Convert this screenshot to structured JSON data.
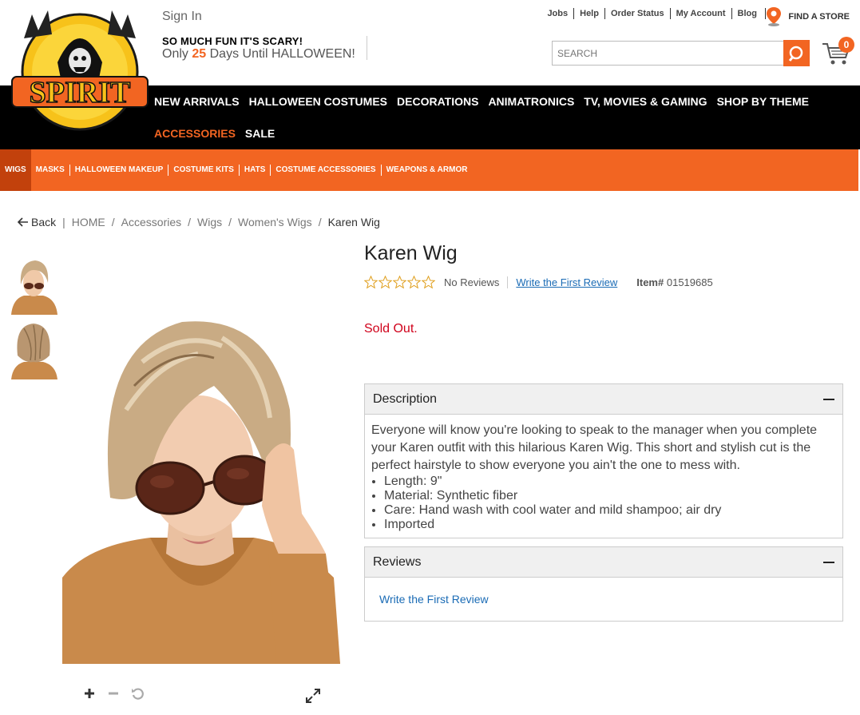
{
  "header": {
    "sign_in": "Sign In",
    "tagline_line1": "SO MUCH FUN IT'S SCARY!",
    "tagline_only": "Only",
    "tagline_days": "25",
    "tagline_rest": "Days Until HALLOWEEN!",
    "top_links": [
      "Jobs",
      "Help",
      "Order Status",
      "My Account",
      "Blog"
    ],
    "find_store": "FIND A STORE",
    "search_placeholder": "SEARCH",
    "cart_count": "0",
    "logo_text": "SPIRIT"
  },
  "main_nav": {
    "row1": [
      "NEW ARRIVALS",
      "HALLOWEEN COSTUMES",
      "DECORATIONS",
      "ANIMATRONICS",
      "TV, MOVIES & GAMING",
      "SHOP BY THEME"
    ],
    "row2": [
      "ACCESSORIES",
      "SALE"
    ],
    "active": "ACCESSORIES"
  },
  "sub_nav": {
    "items": [
      "WIGS",
      "MASKS",
      "HALLOWEEN MAKEUP",
      "COSTUME KITS",
      "HATS",
      "COSTUME ACCESSORIES",
      "WEAPONS & ARMOR"
    ],
    "selected": "WIGS"
  },
  "breadcrumb": {
    "back": "Back",
    "items": [
      "HOME",
      "Accessories",
      "Wigs",
      "Women's Wigs",
      "Karen Wig"
    ]
  },
  "product": {
    "title": "Karen Wig",
    "rating_stars": 0,
    "reviews_text": "No Reviews",
    "first_review_link": "Write the First Review",
    "item_label": "Item#",
    "item_number": "01519685",
    "status": "Sold Out."
  },
  "description": {
    "header": "Description",
    "text": "Everyone will know you're looking to speak to the manager when you complete your Karen outfit with this hilarious Karen Wig. This short and stylish cut is the perfect hairstyle to show everyone you ain't the one to mess with.",
    "bullets": [
      "Length: 9\"",
      "Material: Synthetic fiber",
      "Care: Hand wash with cool water and mild shampoo; air dry",
      "Imported"
    ]
  },
  "reviews": {
    "header": "Reviews",
    "link": "Write the First Review"
  },
  "colors": {
    "brand_orange": "#f26522",
    "nav_black": "#000000",
    "sold_out_red": "#d0021b",
    "link_blue": "#1a6bb5"
  }
}
